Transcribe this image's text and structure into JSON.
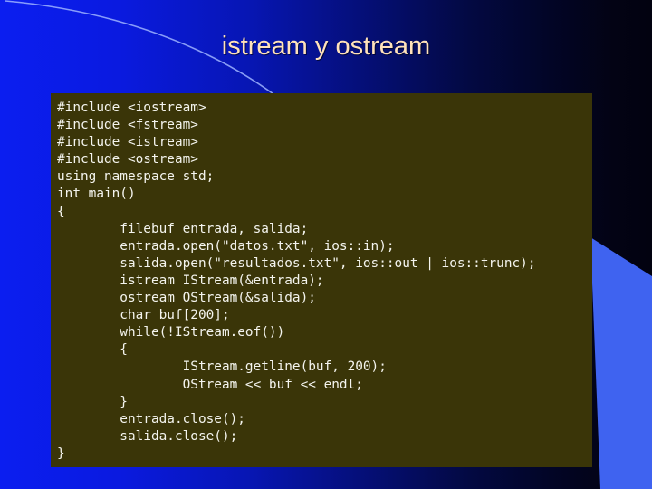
{
  "slide": {
    "title": "istream y ostream",
    "title_color": "#ffe2bb",
    "background_left_color": "#0b1ef0",
    "background_right_color": "#030314",
    "accent_color": "#3f63f0",
    "arc_color": "#9fb4ff"
  },
  "code_panel": {
    "background_color": "#3a3508",
    "text_color": "#f4f4ee",
    "language": "cpp",
    "lines": [
      "#include <iostream>",
      "#include <fstream>",
      "#include <istream>",
      "#include <ostream>",
      "using namespace std;",
      "int main()",
      "{",
      "        filebuf entrada, salida;",
      "        entrada.open(\"datos.txt\", ios::in);",
      "        salida.open(\"resultados.txt\", ios::out | ios::trunc);",
      "        istream IStream(&entrada);",
      "        ostream OStream(&salida);",
      "        char buf[200];",
      "        while(!IStream.eof())",
      "        {",
      "                IStream.getline(buf, 200);",
      "                OStream << buf << endl;",
      "        }",
      "        entrada.close();",
      "        salida.close();",
      "}"
    ]
  }
}
